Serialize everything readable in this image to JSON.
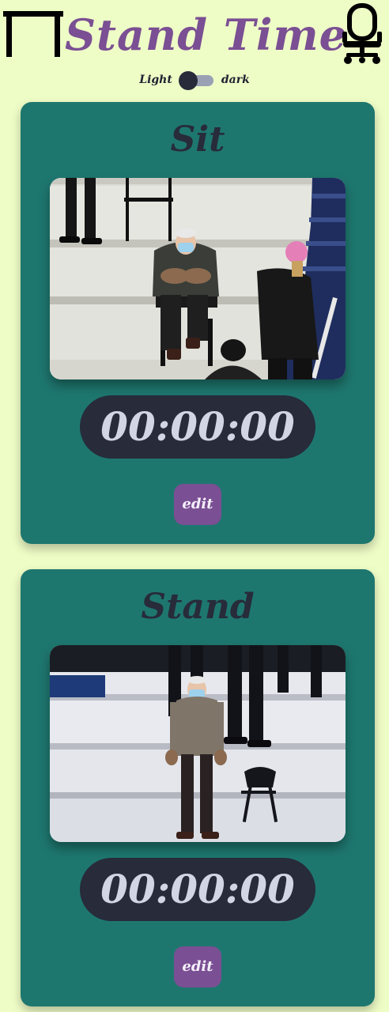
{
  "header": {
    "title": "Stand Time",
    "left_icon": "standing-desk-icon",
    "right_icon": "office-chair-icon"
  },
  "theme_toggle": {
    "light_label": "Light",
    "dark_label": "dark",
    "state": "light"
  },
  "cards": [
    {
      "title": "Sit",
      "photo_subject": "man in mittens sitting on folding chair",
      "timer": "00:00:00",
      "edit_label": "edit"
    },
    {
      "title": "Stand",
      "photo_subject": "man in mittens standing on bleacher step",
      "timer": "00:00:00",
      "edit_label": "edit"
    }
  ],
  "colors": {
    "background": "#eefcc6",
    "accent_purple": "#7a4f93",
    "card_teal": "#1e776f",
    "dark_navy": "#272b3a",
    "timer_text": "#d2d6e4"
  }
}
